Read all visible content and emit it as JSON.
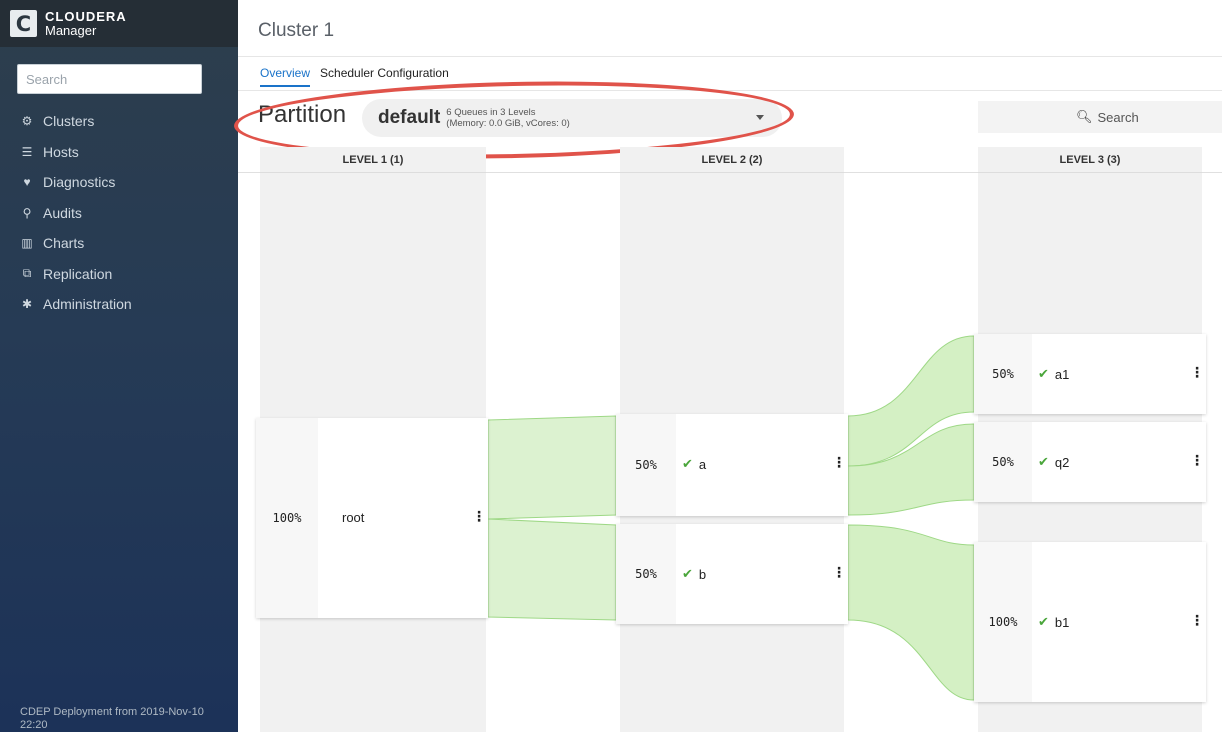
{
  "brand": {
    "logo_letter": "C",
    "name": "CLOUDERA",
    "sub": "Manager"
  },
  "sidebar": {
    "search_placeholder": "Search",
    "items": [
      {
        "label": "Clusters",
        "icon": "clusters-icon",
        "glyph": "⚙"
      },
      {
        "label": "Hosts",
        "icon": "hosts-icon",
        "glyph": "☰"
      },
      {
        "label": "Diagnostics",
        "icon": "diagnostics-icon",
        "glyph": "♥"
      },
      {
        "label": "Audits",
        "icon": "audits-icon",
        "glyph": "⚲"
      },
      {
        "label": "Charts",
        "icon": "charts-icon",
        "glyph": "▥"
      },
      {
        "label": "Replication",
        "icon": "replication-icon",
        "glyph": "⧉"
      },
      {
        "label": "Administration",
        "icon": "administration-icon",
        "glyph": "✱"
      }
    ],
    "footer_line1": "CDEP Deployment from 2019-Nov-10",
    "footer_line2": "22:20"
  },
  "main": {
    "title": "Cluster 1",
    "tabs": [
      {
        "label": "Overview",
        "active": true
      },
      {
        "label": "Scheduler Configuration",
        "active": false
      }
    ],
    "partition": {
      "label": "Partition",
      "name": "default",
      "info_line1": "6 Queues in 3 Levels",
      "info_line2": "(Memory: 0.0 GiB, vCores: 0)"
    },
    "queue_search_placeholder": "Search",
    "levels": [
      {
        "label": "LEVEL 1 (1)"
      },
      {
        "label": "LEVEL 2 (2)"
      },
      {
        "label": "LEVEL 3 (3)"
      }
    ],
    "queues": {
      "root": {
        "pct": "100%",
        "name": "root"
      },
      "a": {
        "pct": "50%",
        "name": "a"
      },
      "b": {
        "pct": "50%",
        "name": "b"
      },
      "a1": {
        "pct": "50%",
        "name": "a1"
      },
      "q2": {
        "pct": "50%",
        "name": "q2"
      },
      "b1": {
        "pct": "100%",
        "name": "b1"
      }
    },
    "colors": {
      "accent": "#1a73c9",
      "check": "#4aa63b",
      "flow": "#c9ecb8",
      "flow_stroke": "#8fd074",
      "highlight": "#e0534a"
    }
  }
}
